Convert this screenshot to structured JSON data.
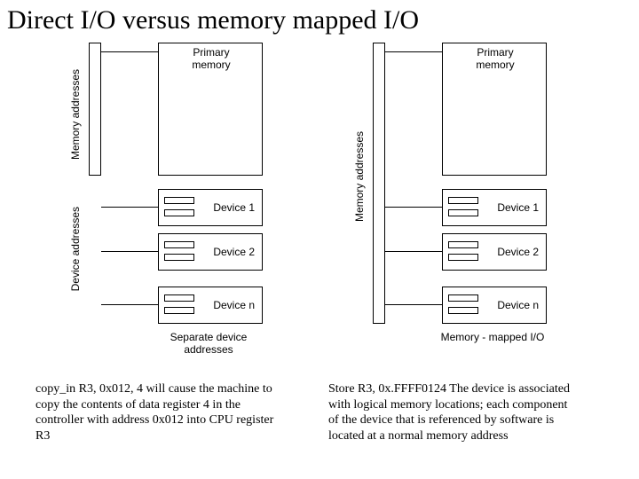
{
  "title": "Direct I/O versus memory mapped I/O",
  "left": {
    "mem_label": "Memory addresses",
    "dev_label": "Device addresses",
    "primary": "Primary\nmemory",
    "d1": "Device 1",
    "d2": "Device 2",
    "dn": "Device n",
    "caption": "Separate device\naddresses"
  },
  "right": {
    "mem_label": "Memory addresses",
    "primary": "Primary\nmemory",
    "d1": "Device 1",
    "d2": "Device 2",
    "dn": "Device n",
    "caption": "Memory - mapped I/O"
  },
  "footer_left": "copy_in R3, 0x012, 4\nwill cause the machine to copy the contents of data register 4 in the controller with address 0x012 into CPU register R3",
  "footer_right": "Store R3, 0x.FFFF0124\nThe device is associated with logical memory locations; each component of the device that is referenced by software is located at a normal memory address"
}
